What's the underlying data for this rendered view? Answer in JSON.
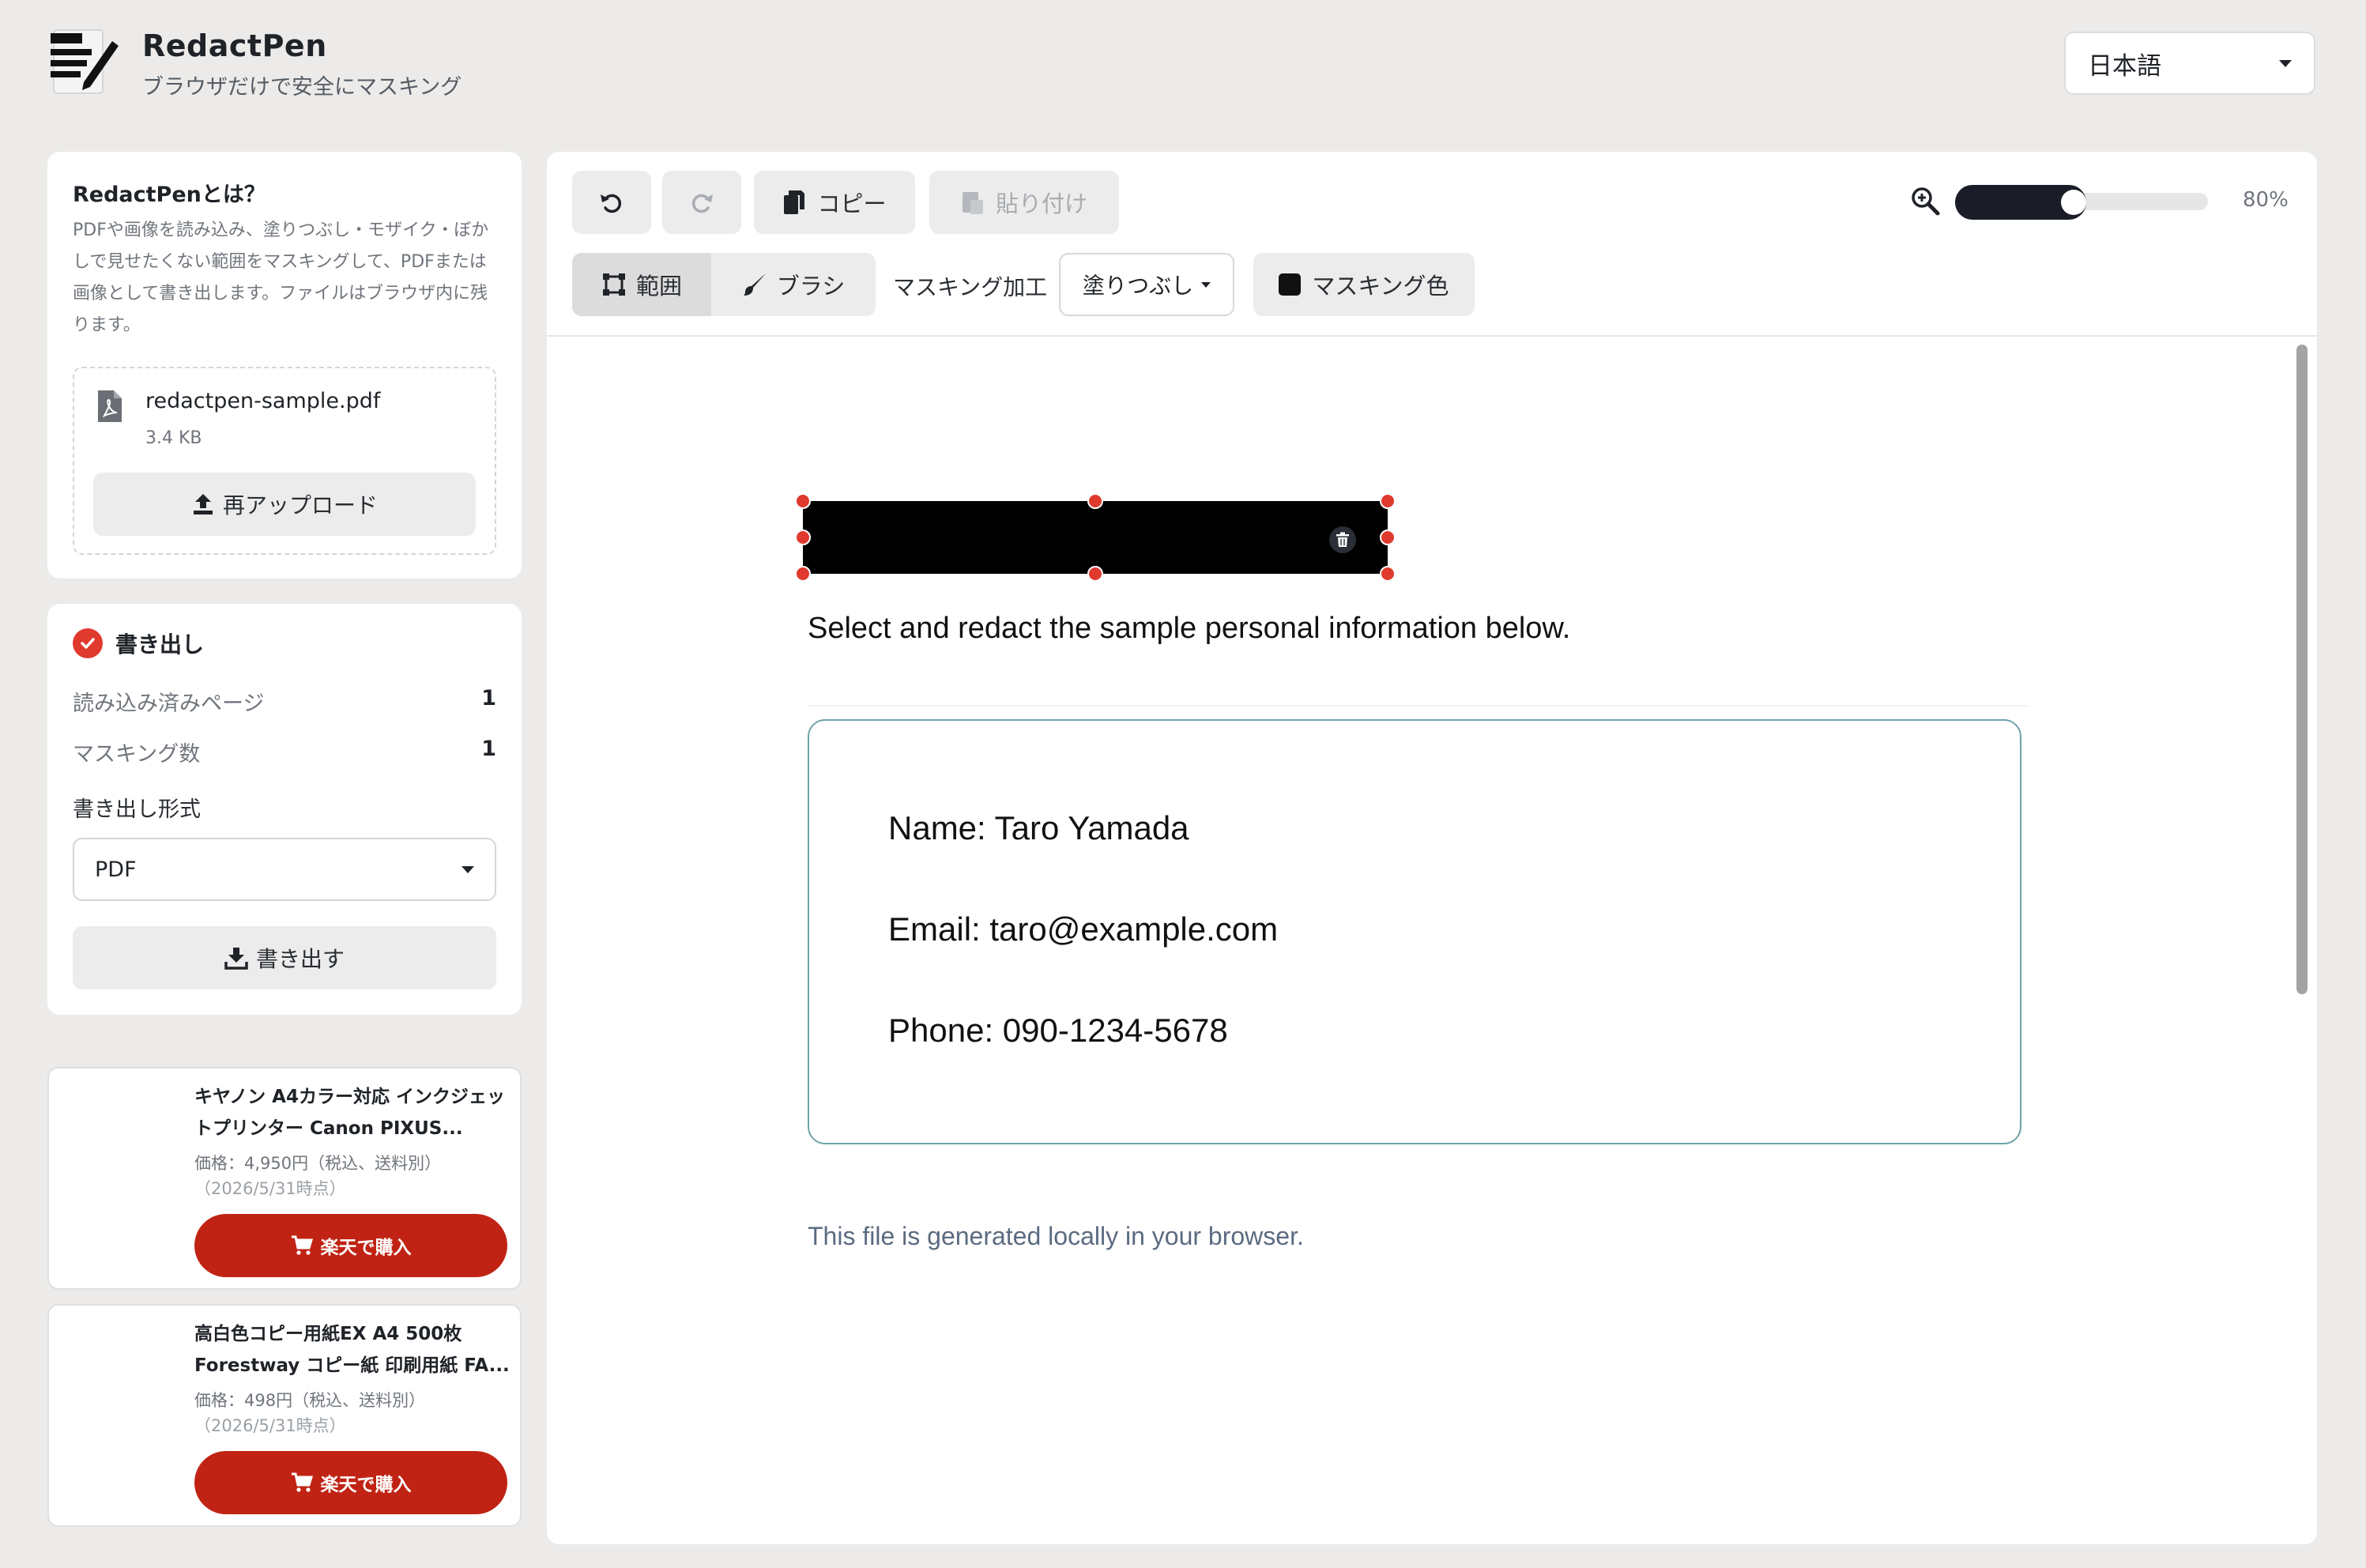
{
  "header": {
    "app_name": "RedactPen",
    "tagline": "ブラウザだけで安全にマスキング",
    "language": "日本語"
  },
  "about": {
    "title": "RedactPenとは？",
    "description": "PDFや画像を読み込み、塗りつぶし・モザイク・ぼかしで見せたくない範囲をマスキングして、PDFまたは画像として書き出します。ファイルはブラウザ内に残ります。",
    "file_name": "redactpen-sample.pdf",
    "file_size": "3.4 KB",
    "reupload_label": "再アップロード"
  },
  "export": {
    "title": "書き出し",
    "pages_label": "読み込み済みページ",
    "pages_value": "1",
    "mask_count_label": "マスキング数",
    "mask_count_value": "1",
    "format_label": "書き出し形式",
    "format_value": "PDF",
    "export_button": "書き出す"
  },
  "ads": [
    {
      "title": "キヤノン A4カラー対応 インクジェットプリンター Canon PIXUS...",
      "price": "価格：4,950円（税込、送料別）",
      "date": "（2026/5/31時点）",
      "button": "楽天で購入"
    },
    {
      "title": "高白色コピー用紙EX A4 500枚 Forestway コピー紙 印刷用紙 FA...",
      "price": "価格：498円（税込、送料別）",
      "date": "（2026/5/31時点）",
      "button": "楽天で購入"
    }
  ],
  "toolbar": {
    "copy_label": "コピー",
    "paste_label": "貼り付け",
    "zoom_label": "80%",
    "zoom_level": 0.5,
    "range_label": "範囲",
    "brush_label": "ブラシ",
    "mask_process_label": "マスキング加工",
    "mask_type_value": "塗りつぶし",
    "mask_color_label": "マスキング色",
    "mask_color": "#111111"
  },
  "document": {
    "intro": "Select and redact the sample personal information below.",
    "name_line": "Name: Taro Yamada",
    "email_line": "Email: taro@example.com",
    "phone_line": "Phone: 090-1234-5678",
    "footer": "This file is generated locally in your browser."
  },
  "colors": {
    "accent_red": "#e03a2e",
    "buy_button": "#c02314",
    "slider_dark": "#1a1d27",
    "info_border": "#6fa3a8"
  }
}
